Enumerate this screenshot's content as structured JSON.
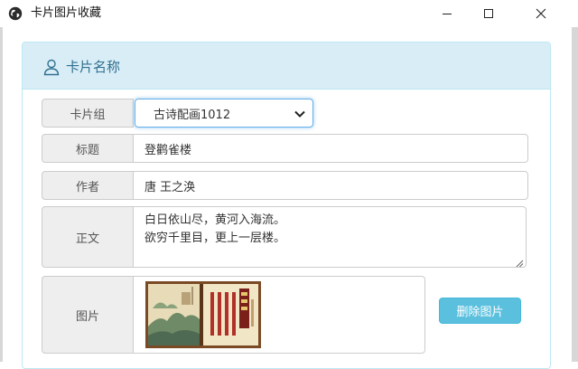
{
  "window": {
    "title": "卡片图片收藏",
    "app_icon": "globe-icon",
    "controls": [
      "minimize-icon",
      "maximize-icon",
      "close-icon"
    ]
  },
  "panel": {
    "title": "卡片名称",
    "icon": "user-icon",
    "heading_color": "#d9edf7",
    "title_color": "#31708f"
  },
  "form": {
    "group": {
      "label": "卡片组",
      "value": "古诗配画1012"
    },
    "title": {
      "label": "标题",
      "value": "登鹳雀楼"
    },
    "author": {
      "label": "作者",
      "value": "唐 王之涣"
    },
    "body": {
      "label": "正文",
      "lines": [
        "白日依山尽，黄河入海流。",
        "欲穷千里目，更上一层楼。"
      ]
    },
    "image": {
      "label": "图片"
    }
  },
  "buttons": {
    "delete_image": "删除图片",
    "delete_color": "#5bc0de"
  }
}
